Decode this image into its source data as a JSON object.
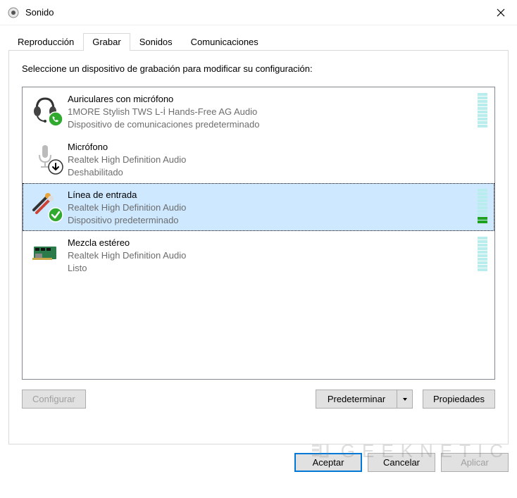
{
  "window": {
    "title": "Sonido"
  },
  "tabs": {
    "items": [
      {
        "label": "Reproducción"
      },
      {
        "label": "Grabar"
      },
      {
        "label": "Sonidos"
      },
      {
        "label": "Comunicaciones"
      }
    ],
    "active_index": 1
  },
  "instruction": "Seleccione un dispositivo de grabación para modificar su configuración:",
  "devices": [
    {
      "name": "Auriculares con micrófono",
      "driver": "1MORE Stylish TWS L-İ Hands-Free AG Audio",
      "status": "Dispositivo de comunicaciones predeterminado",
      "icon": "headset",
      "badge": "phone-green",
      "selected": false,
      "vu_level": 0,
      "vu_segments": 10
    },
    {
      "name": "Micrófono",
      "driver": "Realtek High Definition Audio",
      "status": "Deshabilitado",
      "icon": "microphone",
      "badge": "down-arrow",
      "selected": false,
      "vu_level": 0,
      "vu_segments": 0
    },
    {
      "name": "Línea de entrada",
      "driver": "Realtek High Definition Audio",
      "status": "Dispositivo predeterminado",
      "icon": "line-in",
      "badge": "check-green",
      "selected": true,
      "vu_level": 2,
      "vu_segments": 10
    },
    {
      "name": "Mezcla estéreo",
      "driver": "Realtek High Definition Audio",
      "status": "Listo",
      "icon": "soundcard",
      "badge": null,
      "selected": false,
      "vu_level": 0,
      "vu_segments": 10
    }
  ],
  "buttons": {
    "configure": "Configurar",
    "set_default": "Predeterminar",
    "properties": "Propiedades",
    "ok": "Aceptar",
    "cancel": "Cancelar",
    "apply": "Aplicar"
  },
  "watermark": "GEEKNETIC"
}
